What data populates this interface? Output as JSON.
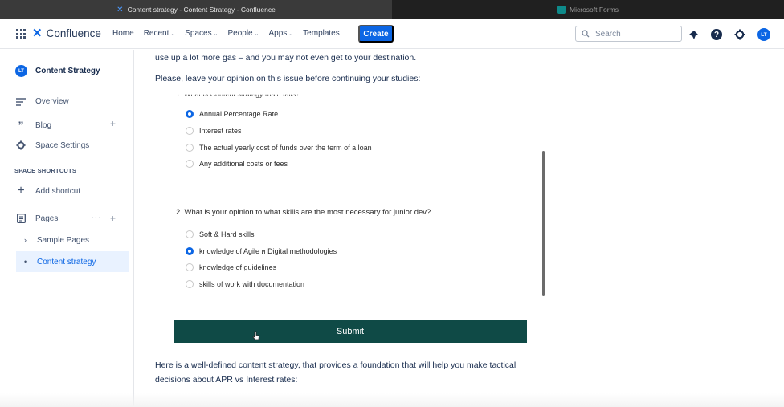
{
  "browser": {
    "tabs": [
      {
        "label": "Content strategy - Content Strategy - Confluence",
        "active": true
      },
      {
        "label": "Microsoft Forms",
        "active": false
      }
    ]
  },
  "topnav": {
    "product": "Confluence",
    "items": [
      {
        "label": "Home",
        "dropdown": false
      },
      {
        "label": "Recent",
        "dropdown": true
      },
      {
        "label": "Spaces",
        "dropdown": true
      },
      {
        "label": "People",
        "dropdown": true
      },
      {
        "label": "Apps",
        "dropdown": true
      },
      {
        "label": "Templates",
        "dropdown": false
      }
    ],
    "create_label": "Create",
    "search_placeholder": "Search",
    "avatar_initials": "LT",
    "accent": "#0c66e4"
  },
  "sidebar": {
    "space_initials": "LT",
    "space_name": "Content Strategy",
    "items": [
      {
        "label": "Overview",
        "icon": "overview-icon"
      },
      {
        "label": "Blog",
        "icon": "quote-icon"
      },
      {
        "label": "Space Settings",
        "icon": "gear-icon"
      }
    ],
    "shortcuts_heading": "SPACE SHORTCUTS",
    "add_shortcut_label": "Add shortcut",
    "pages_label": "Pages",
    "pages_dots": "···",
    "children": [
      {
        "label": "Sample Pages",
        "active": false
      },
      {
        "label": "Content strategy",
        "active": true
      }
    ]
  },
  "content": {
    "intro_line": "use up a lot more gas – and you may not even get to your destination.",
    "prompt": "Please, leave your opinion on this issue before continuing your studies:",
    "form": {
      "q1_title": "1. What is Content strategy main fails?",
      "q1_options": [
        {
          "label": "Annual Percentage Rate",
          "selected": true
        },
        {
          "label": "Interest rates",
          "selected": false
        },
        {
          "label": "The actual yearly cost of funds over the term of a loan",
          "selected": false
        },
        {
          "label": "Any additional costs or fees",
          "selected": false
        }
      ],
      "q2_title": "2. What is your opinion to what skills are the most necessary for junior dev?",
      "q2_options": [
        {
          "label": "Soft & Hard skills",
          "selected": false
        },
        {
          "label": "knowledge of  Agile и Digital methodologies",
          "selected": true
        },
        {
          "label": "knowledge of guidelines",
          "selected": false
        },
        {
          "label": "skills of work with documentation",
          "selected": false
        }
      ],
      "submit_label": "Submit",
      "submit_color": "#0f4a46"
    },
    "outro_line1": "Here is a well-defined content strategy, that provides a foundation that will help you make tactical",
    "outro_line2": "decisions about APR vs Interest rates:"
  }
}
